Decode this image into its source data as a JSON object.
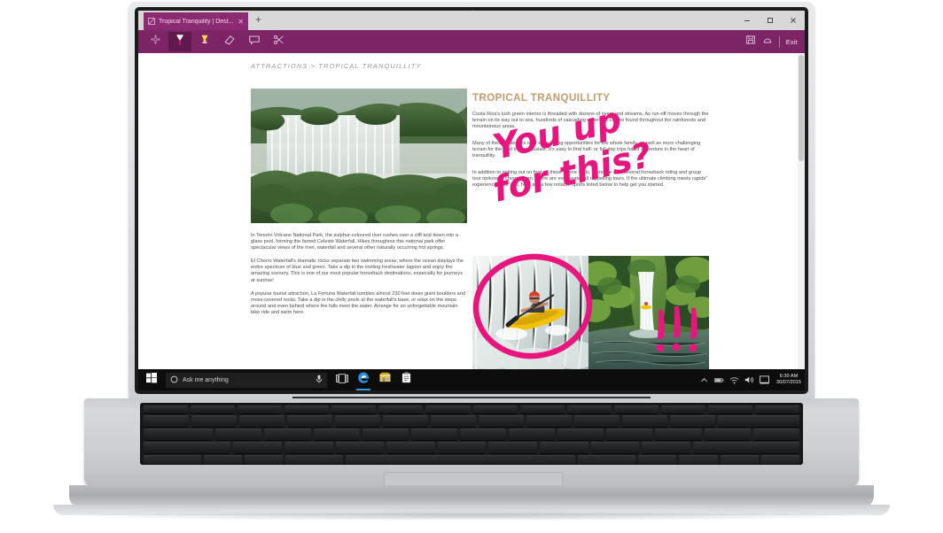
{
  "browser": {
    "tab": {
      "title": "Tropical Tranquility | Dest...",
      "favicon_icon": "page-icon",
      "close_icon": "close-icon"
    },
    "new_tab_label": "+",
    "window_controls": {
      "minimize": "minimize-icon",
      "maximize": "maximize-icon",
      "close": "close-icon"
    },
    "notes_toolbar": {
      "tools": [
        {
          "name": "touch-writing",
          "icon": "move-cursor-icon",
          "active": false
        },
        {
          "name": "pen",
          "icon": "pen-icon",
          "active": true
        },
        {
          "name": "highlighter",
          "icon": "highlighter-icon",
          "active": false
        },
        {
          "name": "eraser",
          "icon": "eraser-icon",
          "active": false
        },
        {
          "name": "add-note",
          "icon": "comment-icon",
          "active": false
        },
        {
          "name": "clip",
          "icon": "scissors-icon",
          "active": false
        }
      ],
      "save_icon": "save-icon",
      "share_icon": "share-icon",
      "exit_label": "Exit"
    }
  },
  "webpage": {
    "breadcrumb": "ATTRACTIONS > TROPICAL TRANQUILLITY",
    "article_title": "TROPICAL TRANQUILLITY",
    "title_color": "#c79a6b",
    "right_paragraphs": [
      "Costa Rica's lush green interior is threaded with dozens of rivers and streams. As run-off moves through the terrain on its way out to sea, hundreds of cascading waterfalls can be found throughout the rainforests and mountainous areas.",
      "Many of these waterfalls offer easy hiking opportunities for the whole family, as well as more challenging terrain for the avid trail enthusiast. It's easy to find half- or full-day trips full of adventure in the heart of tranquillity.",
      "In addition to setting out on foot on these scenic trails, there are also several horseback riding and group tour options to choose from. There are even waterfall rappelling tours. If the ultimate climbing meets rapids\" experience is for you, here are a few notable sports listed below to help get you started."
    ],
    "left_paragraphs": [
      "In Tenorio Volcano National Park, the sulphur-coloured river rushes over a cliff and down into a glass pool, forming the famed Celeste Waterfall. Hikes throughout this national park offer spectacular views of the river, waterfall and several other naturally occurring hot springs.",
      "El Chorro Waterfall's dramatic rocks separate two swimming areas, where the ocean displays the entire spectrum of blue and green. Take a dip in the inviting freshwater lagoon and enjoy the amazing scenery. This is one of our most popular horseback destinations, especially for journeys at sunrise!",
      "A popular tourist attraction, La Fortuna Waterfall tumbles almost 230 feet down giant boulders and moss-covered rocks. Take a dip in the chilly pools at the waterfall's base, or relax on the steps around and even behind where the falls meet the water. Arrange for an unforgettable mountain bike ride and swim here."
    ],
    "hero_image_alt": "Iguazu-style jungle waterfalls panorama",
    "photo_kayak_alt": "Kayaker dropping over a waterfall",
    "photo_falls_alt": "Waterfall plunging into a jungle pool"
  },
  "annotations": {
    "ink_color": "#e8157f",
    "handwriting_text": "You up for this?",
    "exclamation_text": "!!!",
    "circle_label": "ink-circle-around-kayaker"
  },
  "taskbar": {
    "start_icon": "windows-start-icon",
    "search_placeholder": "Ask me anything",
    "search_circle_icon": "cortana-icon",
    "microphone_icon": "microphone-icon",
    "task_view_icon": "task-view-icon",
    "apps": [
      {
        "name": "edge",
        "icon": "edge-icon",
        "active": true
      },
      {
        "name": "store",
        "icon": "store-icon",
        "active": false
      },
      {
        "name": "clipboard-app",
        "icon": "clipboard-icon",
        "active": false
      }
    ],
    "tray": {
      "chevron_icon": "chevron-up-icon",
      "battery_icon": "battery-icon",
      "wifi_icon": "wifi-icon",
      "volume_icon": "volume-icon",
      "action_center_icon": "action-center-icon",
      "time": "6:30 AM",
      "date": "30/07/2015"
    }
  }
}
